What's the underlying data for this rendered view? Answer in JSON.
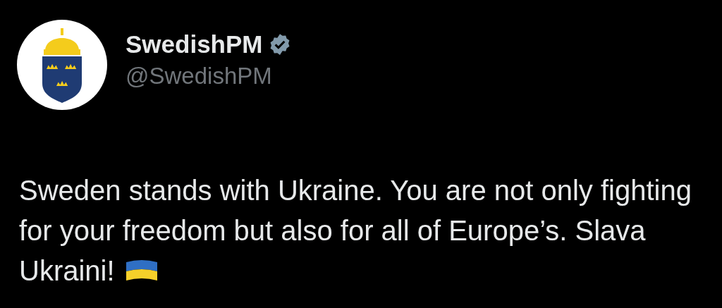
{
  "author": {
    "name": "SwedishPM",
    "verified": true,
    "handle": "@SwedishPM"
  },
  "post": {
    "text": "Sweden stands with Ukraine. You are not only fighting for your freedom but also for all of Europe’s. Slava Ukraini!",
    "flag": true
  }
}
